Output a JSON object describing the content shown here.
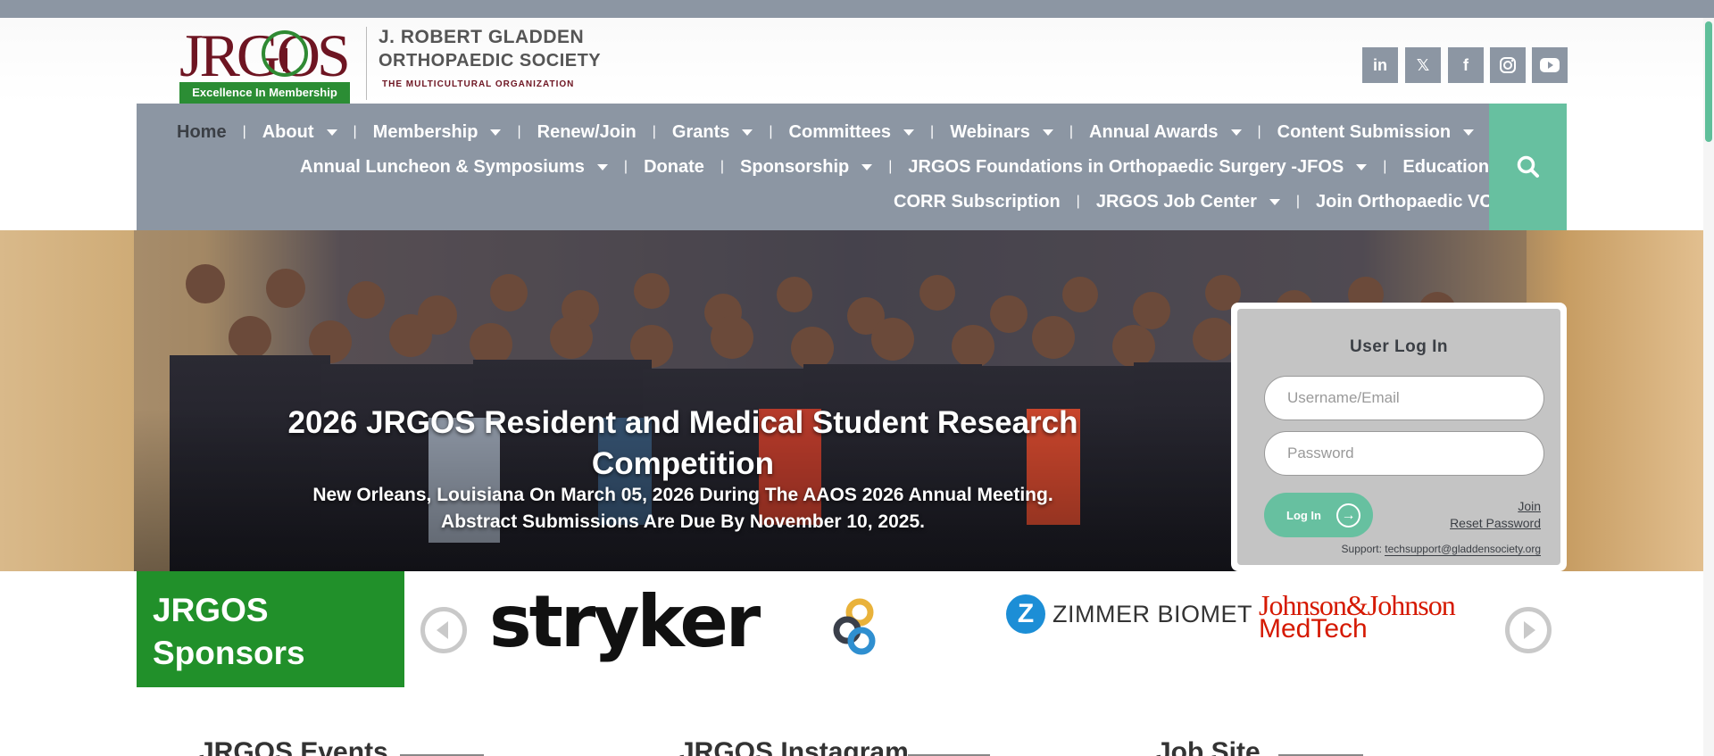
{
  "header": {
    "logo_word": "JRGOS",
    "logo_badge": "Excellence In Membership",
    "org_name_line1": "J. ROBERT GLADDEN",
    "org_name_line2": "ORTHOPAEDIC SOCIETY",
    "org_tagline": "THE MULTICULTURAL ORGANIZATION",
    "social": [
      {
        "icon": "linkedin-icon",
        "glyph": "in"
      },
      {
        "icon": "x-twitter-icon",
        "glyph": "𝕏"
      },
      {
        "icon": "facebook-icon",
        "glyph": "f"
      },
      {
        "icon": "instagram-icon",
        "glyph": ""
      },
      {
        "icon": "youtube-icon",
        "glyph": ""
      }
    ]
  },
  "nav": {
    "row1": [
      "Home",
      "About",
      "Membership",
      "Renew/Join",
      "Grants",
      "Committees",
      "Webinars",
      "Annual Awards",
      "Content Submission"
    ],
    "row2": [
      "Annual Luncheon & Symposiums",
      "Donate",
      "Sponsorship",
      "JRGOS Foundations in Orthopaedic Surgery -JFOS",
      "Education"
    ],
    "row3": [
      "CORR Subscription",
      "JRGOS Job Center",
      "Join Orthopaedic VC"
    ],
    "search_icon": "search-icon"
  },
  "hero": {
    "title": "2026 JRGOS Resident and Medical Student Research Competition",
    "subtitle_line1": "New Orleans, Louisiana On March 05, 2026 During The AAOS 2026 Annual Meeting.",
    "subtitle_line2": "Abstract Submissions Are Due By November 10, 2025."
  },
  "login": {
    "title": "User Log In",
    "username_placeholder": "Username/Email",
    "password_placeholder": "Password",
    "button_label": "Log In",
    "join_link": "Join",
    "reset_link": "Reset Password",
    "support_label": "Support:",
    "support_email": "techsupport@gladdensociety.org"
  },
  "sponsors": {
    "heading_line1": "JRGOS",
    "heading_line2": "Sponsors",
    "stryker": "stryker",
    "zimmer": "ZIMMER BIOMET",
    "zimmer_mark": "Z",
    "jnj_line1": "Johnson&Johnson",
    "jnj_line2": "MedTech"
  },
  "sections": {
    "events": "JRGOS Events",
    "instagram": "JRGOS Instagram",
    "jobsite": "Job Site"
  },
  "colors": {
    "nav_bg": "#8c96a3",
    "accent_green": "#67c0a0",
    "sponsor_green": "#21902a",
    "brand_maroon": "#6e1522"
  }
}
